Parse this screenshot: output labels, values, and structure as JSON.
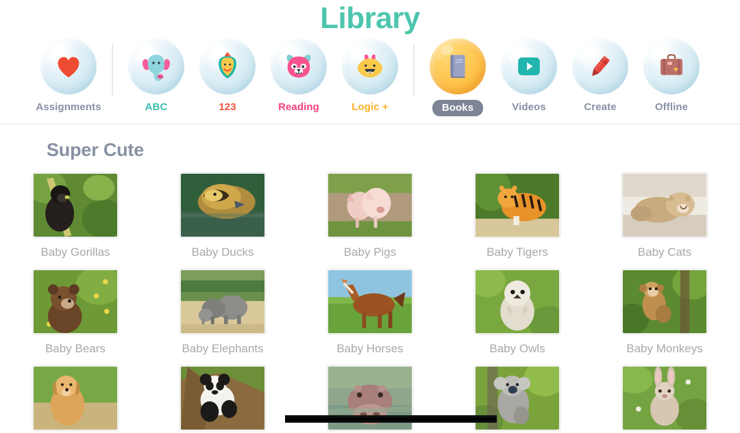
{
  "header": {
    "title": "Library",
    "title_color": "#4ec5ae"
  },
  "nav": {
    "items": [
      {
        "label": "Assignments",
        "icon": "heart-icon",
        "color": "gray",
        "active": false
      },
      {
        "label": "ABC",
        "icon": "elephant-icon",
        "color": "teal",
        "active": false
      },
      {
        "label": "123",
        "icon": "bird-icon",
        "color": "red",
        "active": false
      },
      {
        "label": "Reading",
        "icon": "red-panda-icon",
        "color": "pink",
        "active": false
      },
      {
        "label": "Logic +",
        "icon": "fox-icon",
        "color": "amber",
        "active": false
      },
      {
        "label": "Books",
        "icon": "book-icon",
        "color": "gray",
        "active": true
      },
      {
        "label": "Videos",
        "icon": "play-icon",
        "color": "gray",
        "active": false
      },
      {
        "label": "Create",
        "icon": "crayon-icon",
        "color": "gray",
        "active": false
      },
      {
        "label": "Offline",
        "icon": "suitcase-icon",
        "color": "gray",
        "active": false
      }
    ],
    "divider_after": [
      0,
      4
    ]
  },
  "main": {
    "section_title": "Super Cute",
    "cards": [
      {
        "label": "Baby Gorillas",
        "thumb": "gorilla-thumb"
      },
      {
        "label": "Baby Ducks",
        "thumb": "duck-thumb"
      },
      {
        "label": "Baby Pigs",
        "thumb": "pig-thumb"
      },
      {
        "label": "Baby Tigers",
        "thumb": "tiger-thumb"
      },
      {
        "label": "Baby Cats",
        "thumb": "cat-thumb"
      },
      {
        "label": "Baby Bears",
        "thumb": "bear-thumb"
      },
      {
        "label": "Baby Elephants",
        "thumb": "elephant-thumb"
      },
      {
        "label": "Baby Horses",
        "thumb": "horse-thumb"
      },
      {
        "label": "Baby Owls",
        "thumb": "owl-thumb"
      },
      {
        "label": "Baby Monkeys",
        "thumb": "monkey-thumb"
      },
      {
        "label": "",
        "thumb": "dog-thumb"
      },
      {
        "label": "",
        "thumb": "panda-thumb"
      },
      {
        "label": "",
        "thumb": "hippo-thumb"
      },
      {
        "label": "",
        "thumb": "koala-thumb"
      },
      {
        "label": "",
        "thumb": "rabbit-thumb"
      }
    ]
  },
  "overlay": {
    "bar_color": "#000000"
  }
}
